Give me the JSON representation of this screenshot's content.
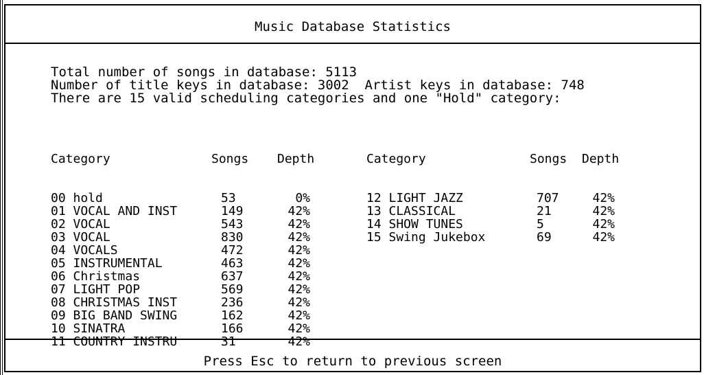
{
  "title": "Music Database Statistics",
  "summary": {
    "total_songs": "Total number of songs in database: 5113",
    "keys_line": "Number of title keys in database: 3002  Artist keys in database: 748",
    "categories_line": "There are 15 valid scheduling categories and one \"Hold\" category:"
  },
  "headers": {
    "category": "Category",
    "songs": "Songs",
    "depth": "Depth"
  },
  "left_table": [
    {
      "category": "00 hold",
      "songs": "53",
      "depth": "0%"
    },
    {
      "category": "01 VOCAL AND INST",
      "songs": "149",
      "depth": "42%"
    },
    {
      "category": "02 VOCAL",
      "songs": "543",
      "depth": "42%"
    },
    {
      "category": "03 VOCAL",
      "songs": "830",
      "depth": "42%"
    },
    {
      "category": "04 VOCALS",
      "songs": "472",
      "depth": "42%"
    },
    {
      "category": "05 INSTRUMENTAL",
      "songs": "463",
      "depth": "42%"
    },
    {
      "category": "06 Christmas",
      "songs": "637",
      "depth": "42%"
    },
    {
      "category": "07 LIGHT POP",
      "songs": "569",
      "depth": "42%"
    },
    {
      "category": "08 CHRISTMAS INST",
      "songs": "236",
      "depth": "42%"
    },
    {
      "category": "09 BIG BAND SWING",
      "songs": "162",
      "depth": "42%"
    },
    {
      "category": "10 SINATRA",
      "songs": "166",
      "depth": "42%"
    },
    {
      "category": "11 COUNTRY INSTRU",
      "songs": "31",
      "depth": "42%"
    }
  ],
  "right_table": [
    {
      "category": "12 LIGHT JAZZ",
      "songs": "707",
      "depth": "42%"
    },
    {
      "category": "13 CLASSICAL",
      "songs": "21",
      "depth": "42%"
    },
    {
      "category": "14 SHOW TUNES",
      "songs": "5",
      "depth": "42%"
    },
    {
      "category": "15 Swing Jukebox",
      "songs": "69",
      "depth": "42%"
    }
  ],
  "footer": "Press Esc to return to previous screen"
}
